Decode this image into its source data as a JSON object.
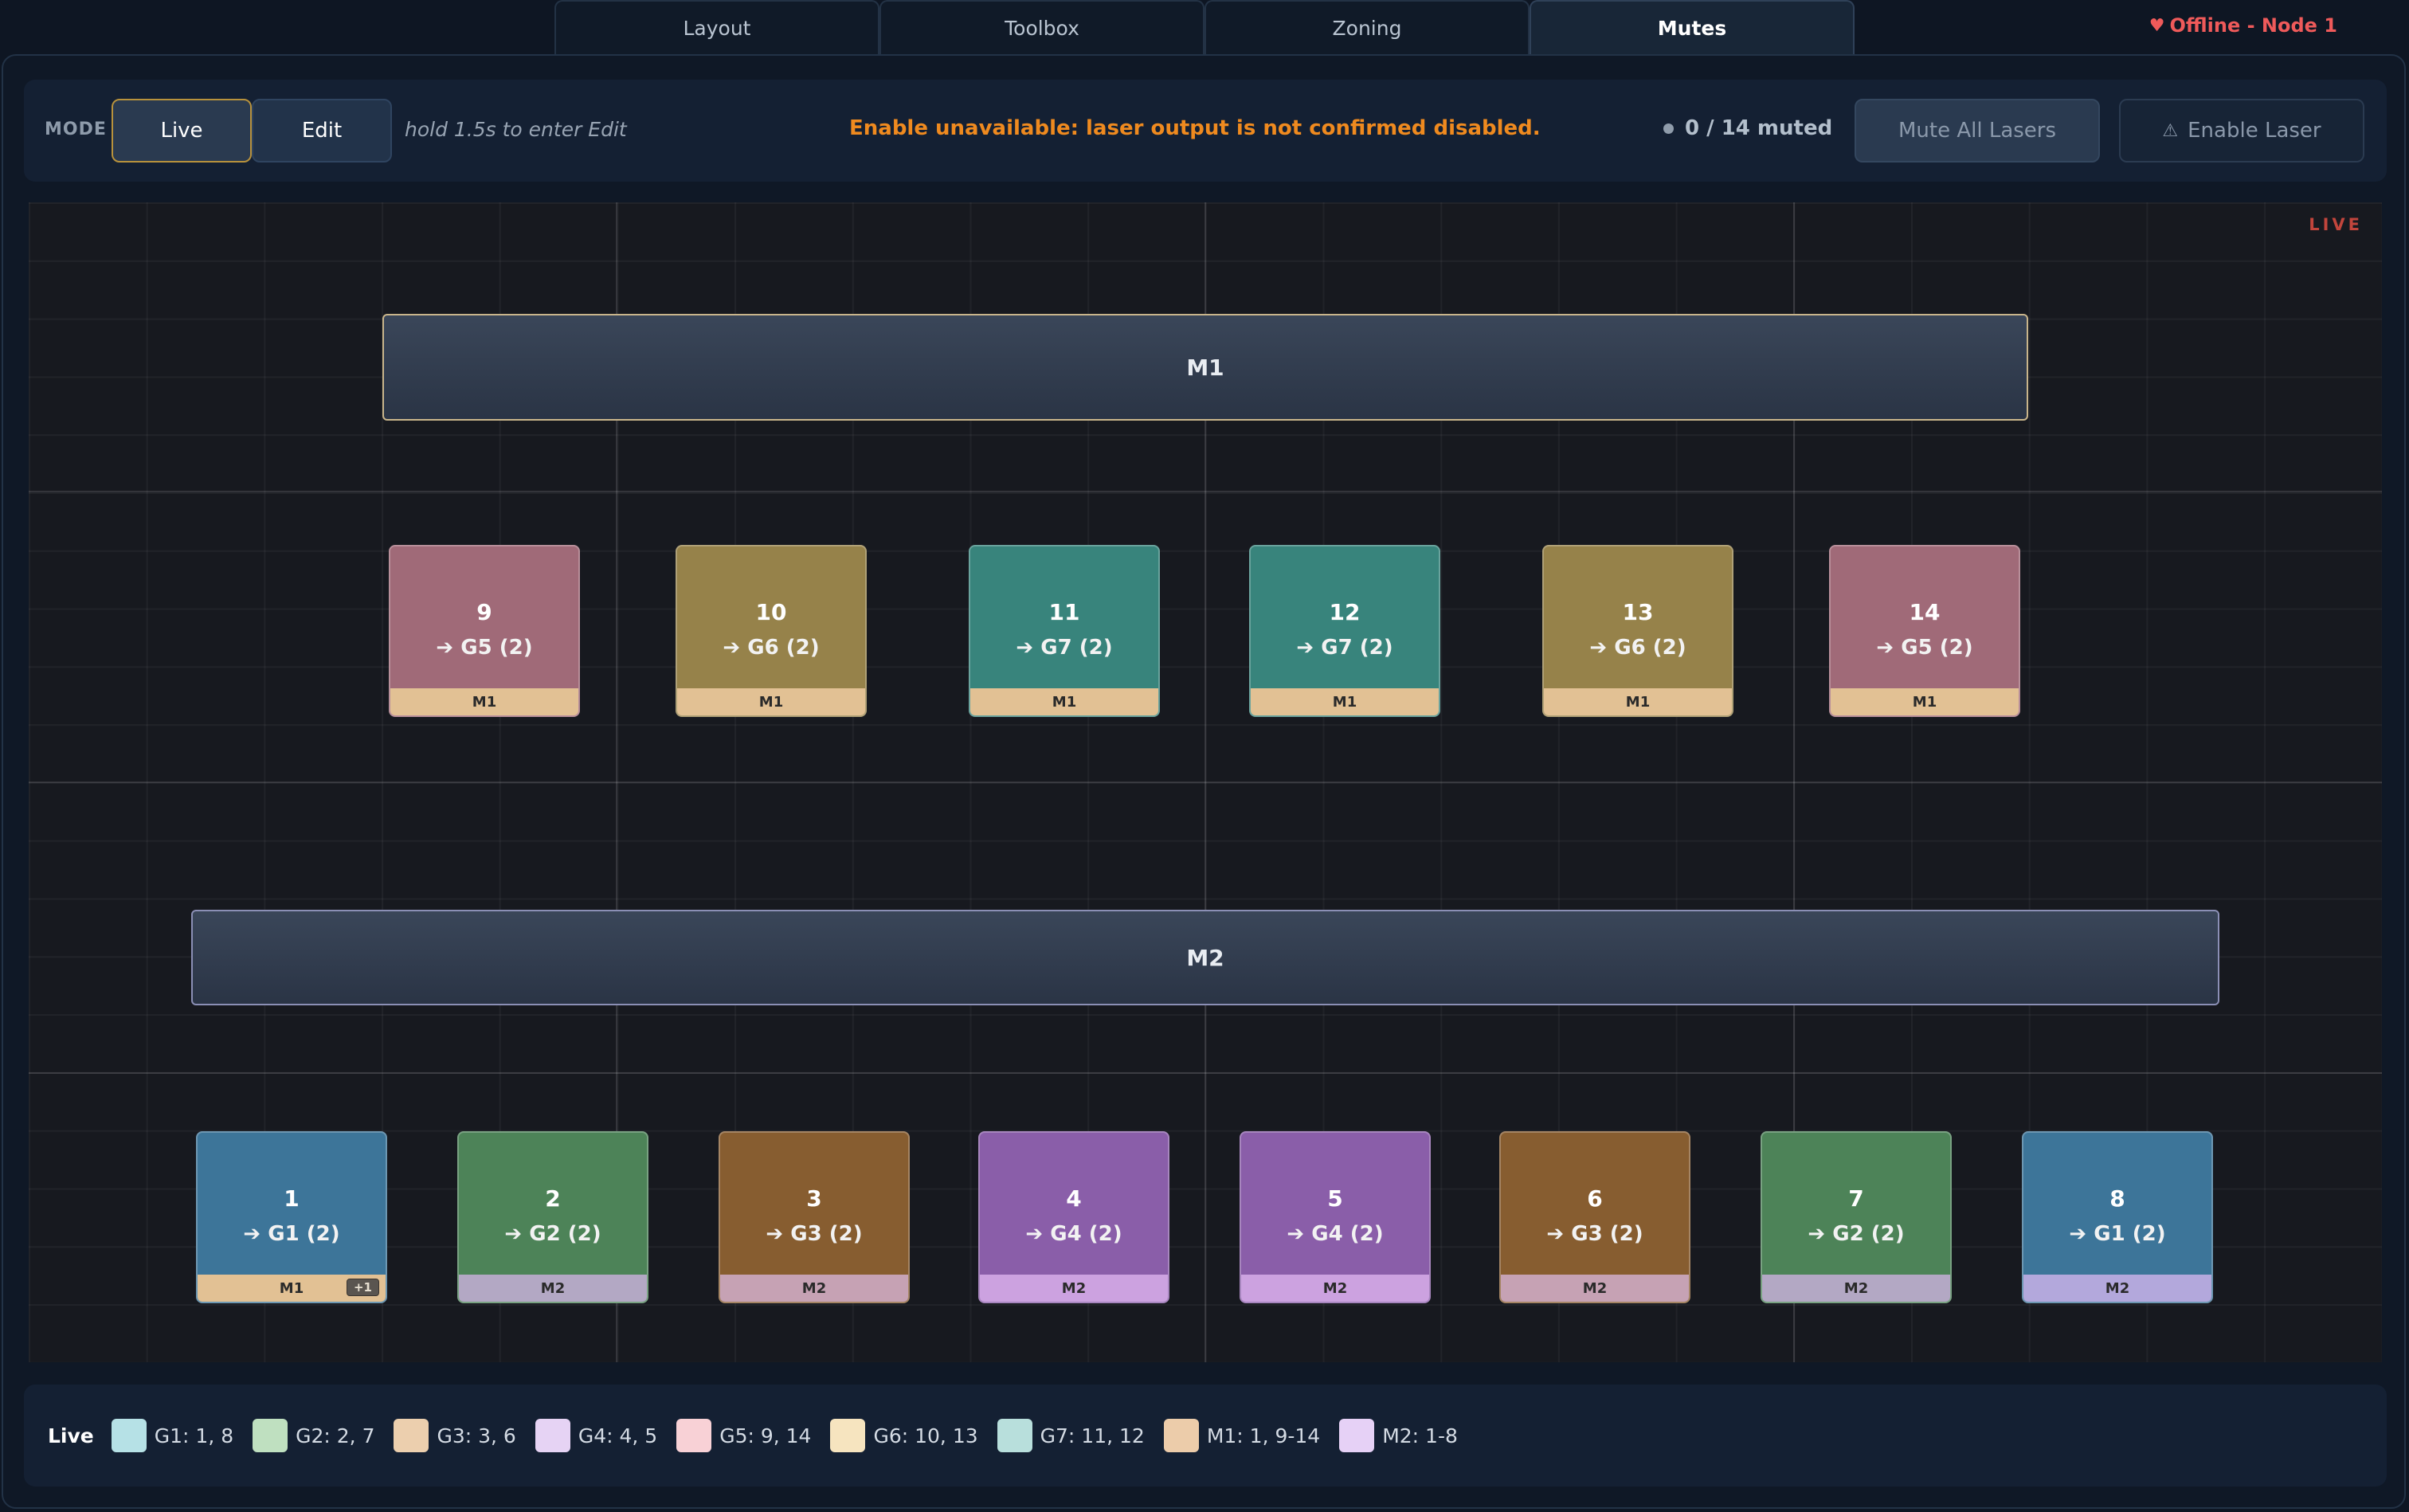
{
  "tabs": [
    {
      "label": "Layout",
      "active": false
    },
    {
      "label": "Toolbox",
      "active": false
    },
    {
      "label": "Zoning",
      "active": false
    },
    {
      "label": "Mutes",
      "active": true
    }
  ],
  "status": {
    "text": "Offline - Node 1",
    "icon": "heart-icon",
    "color": "#ef5a5a"
  },
  "toolbar": {
    "mode_label": "MODE",
    "live_label": "Live",
    "edit_label": "Edit",
    "hint": "hold 1.5s to enter Edit",
    "warning": "Enable unavailable: laser output is not confirmed disabled.",
    "muted_count": "0 / 14 muted",
    "mute_all_label": "Mute All Lasers",
    "enable_laser_label": "Enable Laser",
    "enable_laser_icon": "⚠"
  },
  "canvas": {
    "live_tag": "LIVE",
    "masters": [
      {
        "label": "M1"
      },
      {
        "label": "M2"
      }
    ],
    "lasers": [
      {
        "num": "9",
        "group": "➔ G5 (2)",
        "master": "M1",
        "color": "#a06a78",
        "strip": "#e2c194"
      },
      {
        "num": "10",
        "group": "➔ G6 (2)",
        "master": "M1",
        "color": "#96824a",
        "strip": "#e2c194"
      },
      {
        "num": "11",
        "group": "➔ G7 (2)",
        "master": "M1",
        "color": "#38847c",
        "strip": "#e2c194"
      },
      {
        "num": "12",
        "group": "➔ G7 (2)",
        "master": "M1",
        "color": "#38847c",
        "strip": "#e2c194"
      },
      {
        "num": "13",
        "group": "➔ G6 (2)",
        "master": "M1",
        "color": "#96824a",
        "strip": "#e2c194"
      },
      {
        "num": "14",
        "group": "➔ G5 (2)",
        "master": "M1",
        "color": "#a06a78",
        "strip": "#e2c194"
      },
      {
        "num": "1",
        "group": "➔ G1 (2)",
        "master": "M1",
        "extra": "+1",
        "color": "#3d7599",
        "strip": "#e2c194"
      },
      {
        "num": "2",
        "group": "➔ G2 (2)",
        "master": "M2",
        "color": "#4d8358",
        "strip": "#b3a8c4"
      },
      {
        "num": "3",
        "group": "➔ G3 (2)",
        "master": "M2",
        "color": "#875d30",
        "strip": "#c6a2b4"
      },
      {
        "num": "4",
        "group": "➔ G4 (2)",
        "master": "M2",
        "color": "#8a5ea9",
        "strip": "#cca2e0"
      },
      {
        "num": "5",
        "group": "➔ G4 (2)",
        "master": "M2",
        "color": "#8a5ea9",
        "strip": "#cca2e0"
      },
      {
        "num": "6",
        "group": "➔ G3 (2)",
        "master": "M2",
        "color": "#875d30",
        "strip": "#c6a2b4"
      },
      {
        "num": "7",
        "group": "➔ G2 (2)",
        "master": "M2",
        "color": "#4d8358",
        "strip": "#b3a8c4"
      },
      {
        "num": "8",
        "group": "➔ G1 (2)",
        "master": "M2",
        "color": "#3d7599",
        "strip": "#b3a8dc"
      }
    ]
  },
  "legend": {
    "title": "Live",
    "items": [
      {
        "label": "G1: 1, 8",
        "color": "#b6e1e6"
      },
      {
        "label": "G2: 2, 7",
        "color": "#bfe0c0"
      },
      {
        "label": "G3: 3, 6",
        "color": "#eccfae"
      },
      {
        "label": "G4: 4, 5",
        "color": "#e6d3f4"
      },
      {
        "label": "G5: 9, 14",
        "color": "#f8d1d6"
      },
      {
        "label": "G6: 10, 13",
        "color": "#f6e4bf"
      },
      {
        "label": "G7: 11, 12",
        "color": "#b8dfdc"
      },
      {
        "label": "M1: 1, 9-14",
        "color": "#ecccaa"
      },
      {
        "label": "M2: 1-8",
        "color": "#e6d1f6"
      }
    ]
  }
}
